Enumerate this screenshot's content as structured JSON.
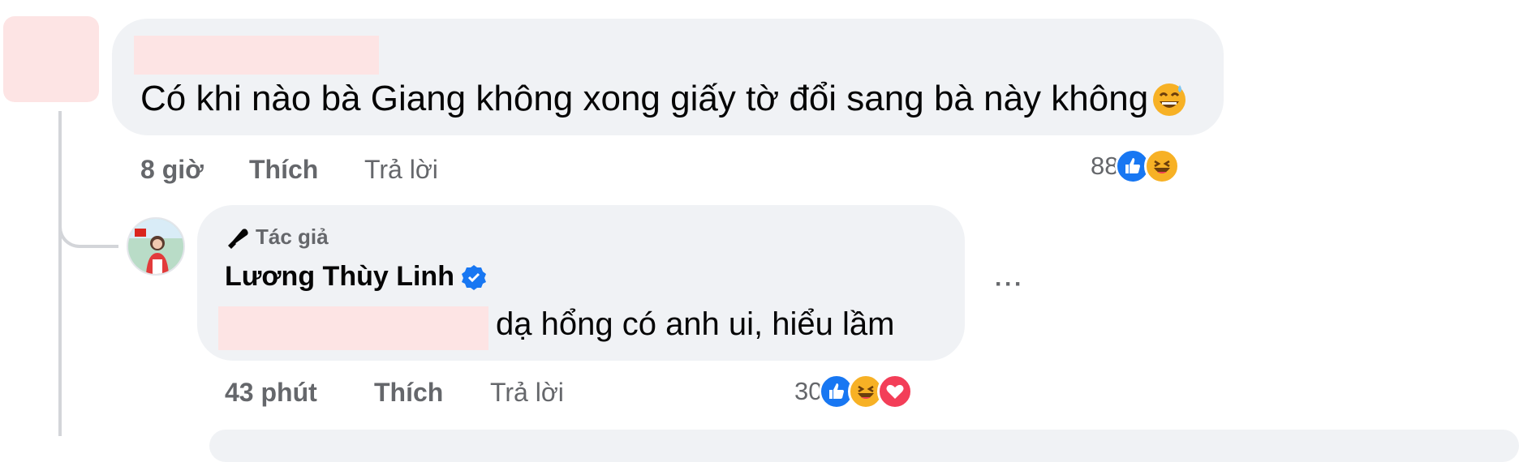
{
  "comment1": {
    "text": "Có khi nào bà Giang không xong giấy tờ đổi sang bà này không",
    "emoji": "sweat-smile-emoji",
    "time": "8 giờ",
    "like_label": "Thích",
    "reply_label": "Trả lời",
    "reaction_count": "88",
    "reactions": [
      "like-reaction-icon",
      "haha-reaction-icon"
    ]
  },
  "reply1": {
    "badge_label": "Tác giả",
    "author_name": "Lương Thùy Linh",
    "verified": true,
    "text": "dạ hổng có anh ui, hiểu lầm",
    "time": "43 phút",
    "like_label": "Thích",
    "reply_label": "Trả lời",
    "reaction_count": "30",
    "reactions": [
      "like-reaction-icon",
      "haha-reaction-icon",
      "love-reaction-icon"
    ],
    "more_label": "···"
  },
  "colors": {
    "bubble_bg": "#f0f2f5",
    "secondary_text": "#65676b",
    "like_blue": "#1877f2",
    "haha_yellow": "#f7b125",
    "love_red": "#f33e58",
    "redaction_pink": "#fde4e4"
  }
}
